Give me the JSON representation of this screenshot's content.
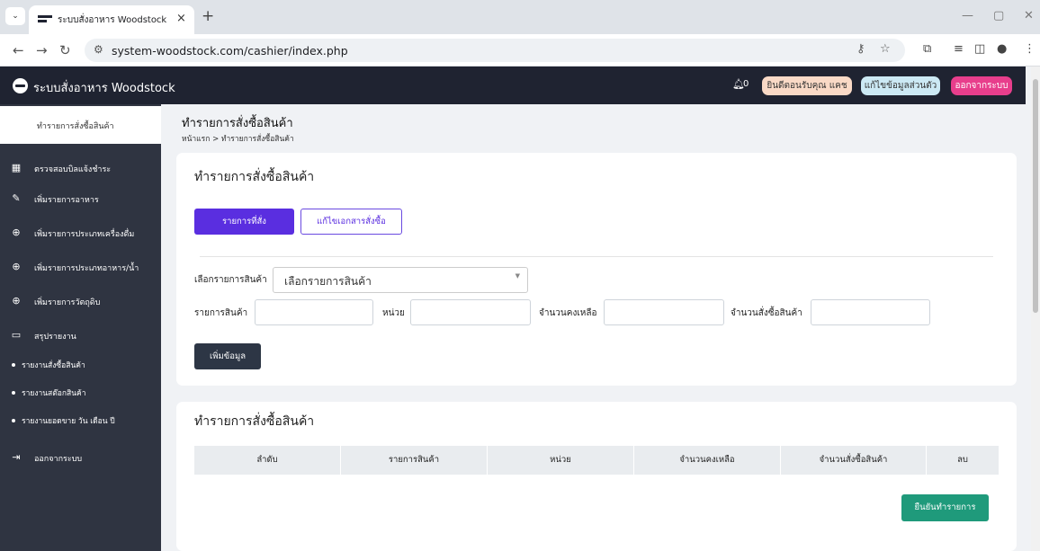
{
  "browser": {
    "tab_title": "ระบบสั่งอาหาร Woodstock",
    "url": "system-woodstock.com/cashier/index.php"
  },
  "header": {
    "brand": "ระบบสั่งอาหาร Woodstock",
    "notifications": "0",
    "welcome": "ยินดีตอนรับคุณ แคช",
    "profile": "แก้ไขข้อมูลส่วนตัว",
    "logout": "ออกจากระบบ"
  },
  "sidebar": {
    "active": "ทำรายการสั่งซื้อสินค้า",
    "items": [
      {
        "label": "ตรวจสอบบิลแจ้งชำระ",
        "icon": "dashboard-icon"
      },
      {
        "label": "เพิ่มรายการอาหาร",
        "icon": "edit-icon"
      },
      {
        "label": "เพิ่มรายการประเภทเครื่องดื่ม",
        "icon": "plus-circle-icon"
      },
      {
        "label": "เพิ่มรายการประเภทอาหาร/น้ำ",
        "icon": "plus-circle-icon"
      },
      {
        "label": "เพิ่มรายการวัตถุดิบ",
        "icon": "plus-circle-icon"
      },
      {
        "label": "สรุปรายงาน",
        "icon": "report-icon"
      }
    ],
    "subitems": [
      "รายงานสั่งซื้อสินค้า",
      "รายงานสต๊อกสินค้า",
      "รายงานยอดขาย วัน เดือน ปี"
    ],
    "logout": "ออกจากระบบ"
  },
  "page": {
    "title": "ทำรายการสั่งซื้อสินค้า",
    "breadcrumb": "หน้าแรก > ทำรายการสั่งซื้อสินค้า"
  },
  "form_card": {
    "title": "ทำรายการสั่งซื้อสินค้า",
    "btn_orders": "รายการที่สั่ง",
    "btn_edit_doc": "แก้ไขเอกสารสั่งซื้อ",
    "select_label": "เลือกรายการสินค้า",
    "select_value": "เลือกรายการสินค้า",
    "product_label": "รายการสินค้า",
    "unit_label": "หน่วย",
    "remaining_label": "จำนวนคงเหลือ",
    "order_qty_label": "จำนวนสั่งซื้อสินค้า",
    "add_btn": "เพิ่มข้อมูล"
  },
  "table_card": {
    "title": "ทำรายการสั่งซื้อสินค้า",
    "columns": [
      "ลำดับ",
      "รายการสินค้า",
      "หน่วย",
      "จำนวนคงเหลือ",
      "จำนวนสั่งซื้อสินค้า",
      "ลบ"
    ],
    "confirm_btn": "ยืนยันทำรายการ"
  }
}
